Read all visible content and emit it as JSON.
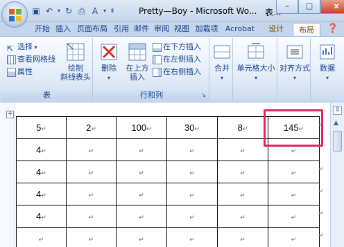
{
  "app": {
    "title": "Pretty—Boy - Microsoft Wo...",
    "ghost_title": "表..."
  },
  "window_controls": {
    "minimize": "–",
    "restore": "□",
    "close": "x"
  },
  "tabs": [
    {
      "label": "开始"
    },
    {
      "label": "插入"
    },
    {
      "label": "页面布局"
    },
    {
      "label": "引用"
    },
    {
      "label": "邮件"
    },
    {
      "label": "审阅"
    },
    {
      "label": "视图"
    },
    {
      "label": "加载项"
    },
    {
      "label": "Acrobat"
    },
    {
      "label": "设计"
    },
    {
      "label": "布局"
    }
  ],
  "active_tab": "布局",
  "ribbon": {
    "table_group": {
      "label": "表",
      "select": "选择",
      "gridlines": "查看网格线",
      "properties": "属性",
      "draw_line1": "绘制",
      "draw_line2": "斜线表头"
    },
    "rows_cols_group": {
      "label": "行和列",
      "delete": "删除",
      "insert_above_line1": "在上方",
      "insert_above_line2": "插入",
      "insert_below": "在下方插入",
      "insert_left": "在左侧插入",
      "insert_right": "在右侧插入"
    },
    "merge": "合并",
    "cell_size": "单元格大小",
    "alignment": "对齐方式",
    "data": "数据"
  },
  "table": {
    "header_row": [
      "5",
      "2",
      "100",
      "30",
      "8",
      "145"
    ],
    "rows": [
      [
        "4",
        "",
        "",
        "",
        "",
        ""
      ],
      [
        "4",
        "",
        "",
        "",
        "",
        ""
      ],
      [
        "4",
        "",
        "",
        "",
        "",
        ""
      ],
      [
        "4",
        "",
        "",
        "",
        "",
        ""
      ],
      [
        "",
        "",
        "",
        "",
        "",
        ""
      ]
    ],
    "cell_mark": "↵"
  },
  "colors": {
    "highlight": "#e0245e",
    "ribbon_text": "#15428b",
    "title_bar": "#c5d6ec"
  }
}
